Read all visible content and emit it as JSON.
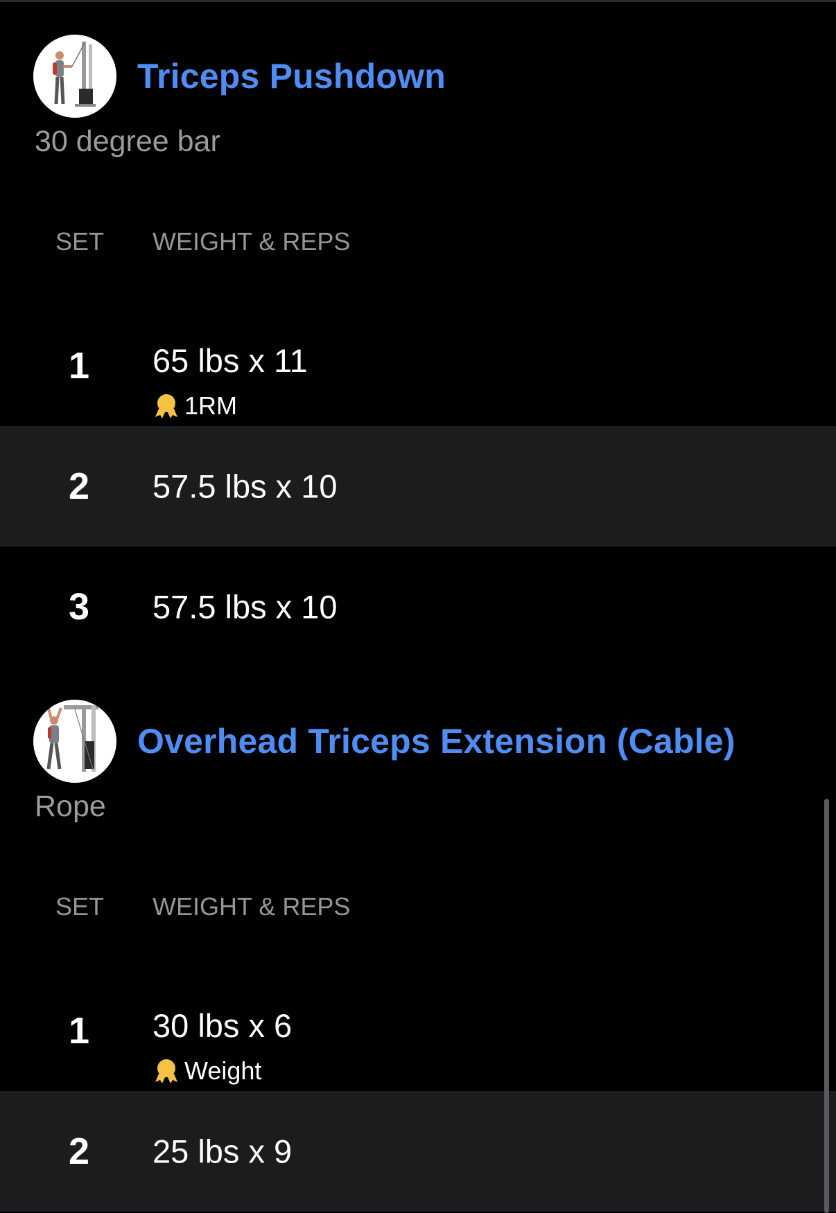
{
  "exercises": [
    {
      "title": "Triceps Pushdown",
      "note": "30 degree bar",
      "columns": {
        "set": "SET",
        "weight_reps": "WEIGHT & REPS"
      },
      "sets": [
        {
          "num": "1",
          "value": "65 lbs x 11",
          "badge": "1RM"
        },
        {
          "num": "2",
          "value": "57.5 lbs x 10"
        },
        {
          "num": "3",
          "value": "57.5 lbs x 10"
        }
      ]
    },
    {
      "title": "Overhead Triceps Extension (Cable)",
      "note": "Rope",
      "columns": {
        "set": "SET",
        "weight_reps": "WEIGHT & REPS"
      },
      "sets": [
        {
          "num": "1",
          "value": "30 lbs x 6",
          "badge": "Weight"
        },
        {
          "num": "2",
          "value": "25 lbs x 9"
        }
      ]
    }
  ],
  "colors": {
    "accent": "#4f8df5",
    "background": "#000000",
    "alt_row": "#1c1c1e",
    "badge": "#f5c242"
  },
  "icons": {
    "exercise_1": "cable-pushdown-illustration-icon",
    "exercise_2": "overhead-cable-extension-illustration-icon",
    "record": "award-medal-icon"
  }
}
